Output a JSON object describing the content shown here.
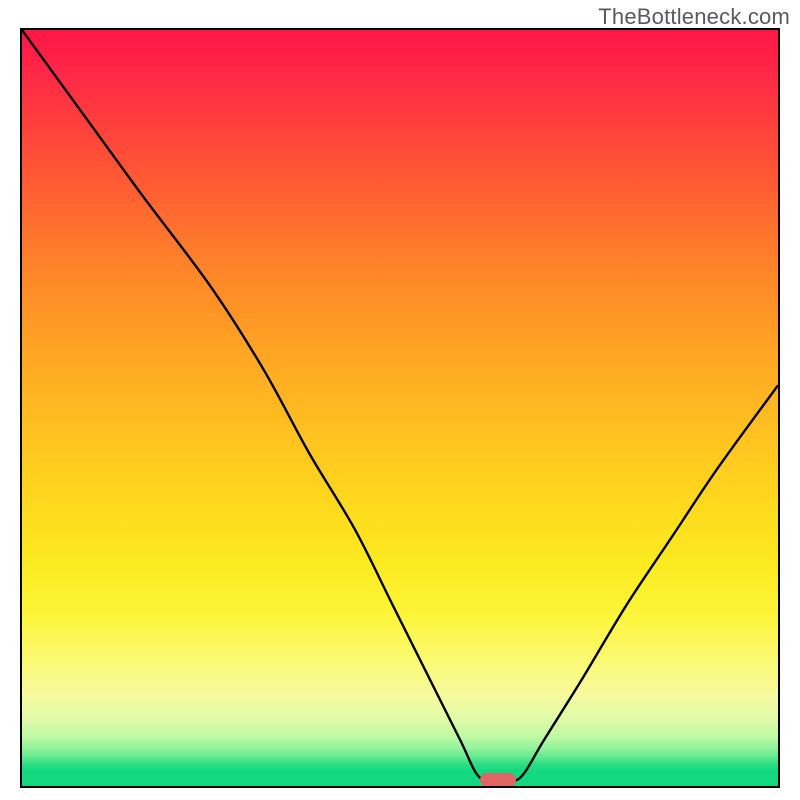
{
  "watermark": "TheBottleneck.com",
  "chart_data": {
    "type": "line",
    "title": "",
    "xlabel": "",
    "ylabel": "",
    "xlim": [
      0,
      100
    ],
    "ylim": [
      0,
      100
    ],
    "grid": false,
    "description": "Bottleneck V-curve on a red-to-green vertical gradient. Y-value encodes bottleneck severity (100 = worst/red top, 0 = best/green bottom). Left branch descends from top-left; right branch descends from upper-right; minimum (no bottleneck) near x ≈ 63.",
    "series": [
      {
        "name": "bottleneck-curve",
        "color": "#000000",
        "points": [
          {
            "x": 0,
            "y": 100
          },
          {
            "x": 8,
            "y": 89
          },
          {
            "x": 16,
            "y": 78
          },
          {
            "x": 25,
            "y": 66
          },
          {
            "x": 32,
            "y": 55
          },
          {
            "x": 38,
            "y": 44
          },
          {
            "x": 44,
            "y": 34
          },
          {
            "x": 49,
            "y": 24
          },
          {
            "x": 54,
            "y": 14
          },
          {
            "x": 58,
            "y": 6
          },
          {
            "x": 60,
            "y": 1.8
          },
          {
            "x": 61.5,
            "y": 0.6
          },
          {
            "x": 63,
            "y": 0.5
          },
          {
            "x": 65,
            "y": 0.6
          },
          {
            "x": 66.5,
            "y": 1.8
          },
          {
            "x": 69,
            "y": 6
          },
          {
            "x": 74,
            "y": 14
          },
          {
            "x": 80,
            "y": 24
          },
          {
            "x": 86,
            "y": 33
          },
          {
            "x": 92,
            "y": 42
          },
          {
            "x": 100,
            "y": 53
          }
        ]
      }
    ],
    "marker": {
      "x": 63,
      "y": 0.5,
      "color": "#e06666",
      "shape": "pill"
    },
    "background_gradient": {
      "direction": "vertical",
      "stops": [
        {
          "pos": 0,
          "color": "#ff1846"
        },
        {
          "pos": 0.3,
          "color": "#ff7f2a"
        },
        {
          "pos": 0.62,
          "color": "#ffd71e"
        },
        {
          "pos": 0.83,
          "color": "#fbf96e"
        },
        {
          "pos": 0.95,
          "color": "#93f39c"
        },
        {
          "pos": 1.0,
          "color": "#13d880"
        }
      ]
    }
  }
}
